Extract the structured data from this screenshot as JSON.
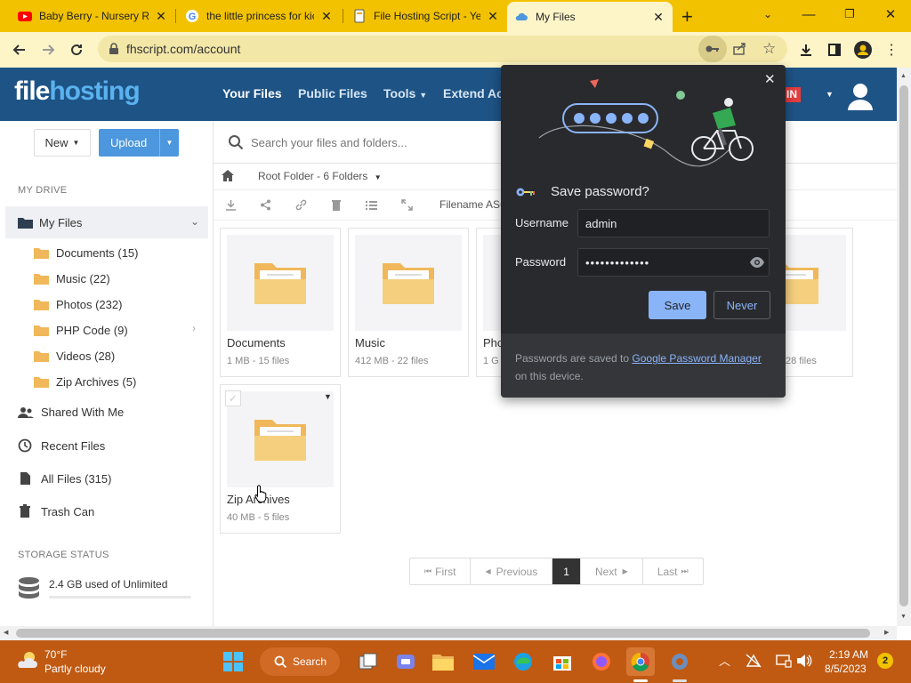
{
  "browser": {
    "tabs": [
      {
        "title": "Baby Berry - Nursery Rh",
        "icon": "youtube-icon"
      },
      {
        "title": "the little princess for kic",
        "icon": "google-icon"
      },
      {
        "title": "File Hosting Script - Ye",
        "icon": "filehosting-icon"
      },
      {
        "title": "My Files",
        "icon": "cloud-icon",
        "active": true
      }
    ],
    "new_tab": "+",
    "url": "fhscript.com/account"
  },
  "site": {
    "logo_part1": "file",
    "logo_part2": "hosting",
    "nav": [
      "Your Files",
      "Public Files",
      "Tools",
      "Extend Ac"
    ],
    "admin_badge": "IN"
  },
  "sidebar": {
    "new_label": "New",
    "upload_label": "Upload",
    "my_drive_label": "MY DRIVE",
    "my_files_label": "My Files",
    "folders": [
      "Documents (15)",
      "Music (22)",
      "Photos (232)",
      "PHP Code (9)",
      "Videos (28)",
      "Zip Archives (5)"
    ],
    "links": [
      "Shared With Me",
      "Recent Files",
      "All Files (315)",
      "Trash Can"
    ],
    "storage_label": "STORAGE STATUS",
    "storage_text": "2.4 GB used of Unlimited",
    "storage_fraction": 0.0
  },
  "main": {
    "search_placeholder": "Search your files and folders...",
    "breadcrumb": "Root Folder - 6 Folders",
    "sort_label": "Filename ASC",
    "cards": [
      {
        "name": "Documents",
        "meta": "1 MB - 15 files"
      },
      {
        "name": "Music",
        "meta": "412 MB - 22 files"
      },
      {
        "name": "Pho",
        "meta": "1 G"
      },
      {
        "name": "",
        "meta": "28 files"
      },
      {
        "name": "Zip Archives",
        "meta": "40 MB - 5 files"
      }
    ],
    "pager": {
      "first": "First",
      "previous": "Previous",
      "current": "1",
      "next": "Next",
      "last": "Last"
    }
  },
  "password_dialog": {
    "title": "Save password?",
    "username_label": "Username",
    "username_value": "admin",
    "password_label": "Password",
    "password_value": "•••••••••••••",
    "save_label": "Save",
    "never_label": "Never",
    "footer_pre": "Passwords are saved to ",
    "footer_link": "Google Password Manager",
    "footer_post": " on this device."
  },
  "taskbar": {
    "temperature": "70°F",
    "weather": "Partly cloudy",
    "search_label": "Search",
    "time": "2:19 AM",
    "date": "8/5/2023",
    "notification_count": "2"
  },
  "colors": {
    "chrome_theme": "#f2c200",
    "site_header": "#1e5385",
    "accent_blue": "#4c97dd",
    "taskbar": "#c05a12",
    "dialog_bg": "#292a2d"
  }
}
